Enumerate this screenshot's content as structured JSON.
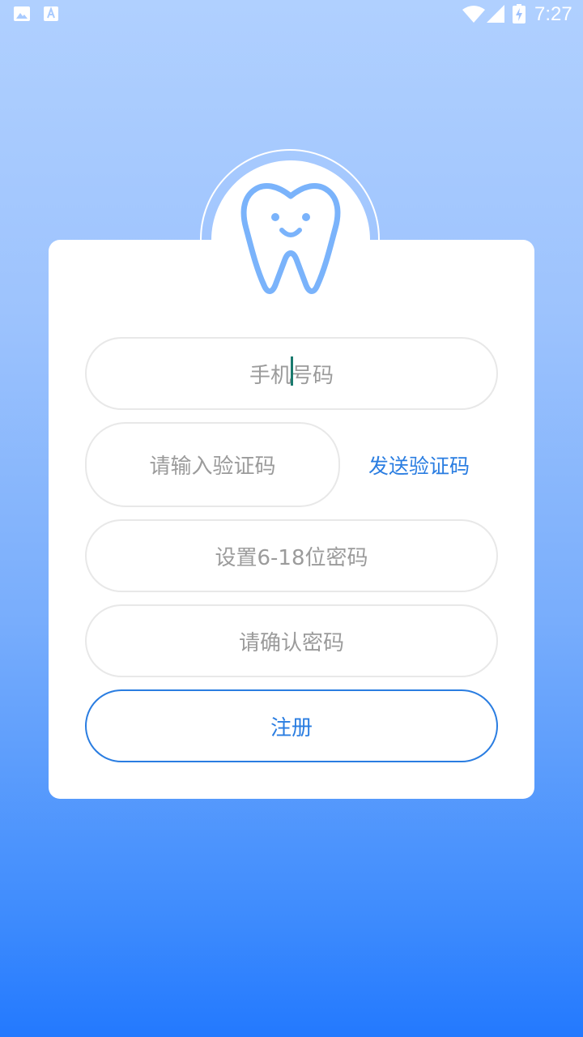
{
  "status_bar": {
    "time": "7:27",
    "icons": [
      "image-icon",
      "a-text-icon",
      "wifi-icon",
      "signal-icon",
      "battery-charging-icon"
    ],
    "icon_color": "#ffffff"
  },
  "logo": {
    "icon": "tooth-icon",
    "color": "#7ab3fb"
  },
  "form": {
    "phone_placeholder_before": "手机",
    "phone_placeholder_after": "号码",
    "code_placeholder": "请输入验证码",
    "send_code_label": "发送验证码",
    "password_placeholder": "设置6-18位密码",
    "confirm_password_placeholder": "请确认密码",
    "register_label": "注册"
  },
  "colors": {
    "accent": "#2a7de1",
    "placeholder": "#9b9b9b",
    "field_border": "#e8e8e8",
    "gradient_top": "#b0d0ff",
    "gradient_bottom": "#2379fe"
  }
}
